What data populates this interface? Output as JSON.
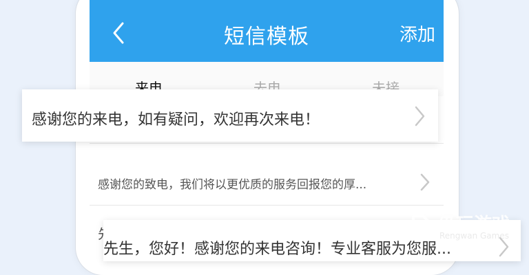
{
  "header": {
    "title": "短信模板",
    "add_label": "添加"
  },
  "tabs": [
    {
      "label": "来电",
      "active": true
    },
    {
      "label": "去电",
      "active": false
    },
    {
      "label": "未接",
      "active": false
    }
  ],
  "templates": [
    {
      "text": "感谢您的来电，如有疑问，欢迎再次来电！"
    },
    {
      "text": "感谢您的致电，我们将以更优质的服务回报您的厚..."
    },
    {
      "text": "先生，您好！感谢您的来电咨询！专业客服为您服..."
    }
  ],
  "partial_row_char": "先",
  "watermark": {
    "brand": "仍玩游戏",
    "sub": "Rengwan Games"
  },
  "colors": {
    "header_bg": "#2fa2ed",
    "background": "#eaf1fb"
  }
}
